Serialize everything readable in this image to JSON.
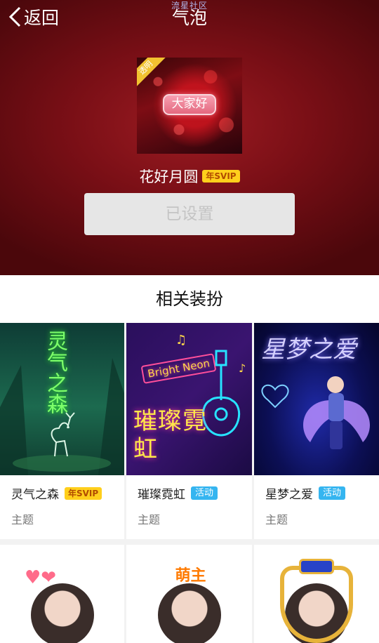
{
  "header": {
    "back_label": "返回",
    "title": "气泡",
    "watermark": "流星社区"
  },
  "preview": {
    "ribbon": "透明",
    "bubble_text": "大家好"
  },
  "item": {
    "name": "花好月圆",
    "badge": "年SVIP",
    "set_button": "已设置"
  },
  "related": {
    "title": "相关装扮",
    "cards": [
      {
        "art_text": "灵气之森",
        "title": "灵气之森",
        "badge": "年SVIP",
        "badge_type": "svip",
        "category": "主题"
      },
      {
        "art_text": "璀璨霓虹",
        "art_sub": "Bright Neon",
        "title": "璀璨霓虹",
        "badge": "活动",
        "badge_type": "activity",
        "category": "主题"
      },
      {
        "art_text": "星梦之爱",
        "title": "星梦之爱",
        "badge": "活动",
        "badge_type": "activity",
        "category": "主题"
      }
    ],
    "row2": [
      {
        "deco": "hearts"
      },
      {
        "deco": "萌主"
      },
      {
        "deco": "crown-frame"
      }
    ]
  },
  "colors": {
    "hero_bg": "#7a0f16",
    "svip_badge": "#ffcf1c",
    "activity_badge": "#35b5f0"
  }
}
